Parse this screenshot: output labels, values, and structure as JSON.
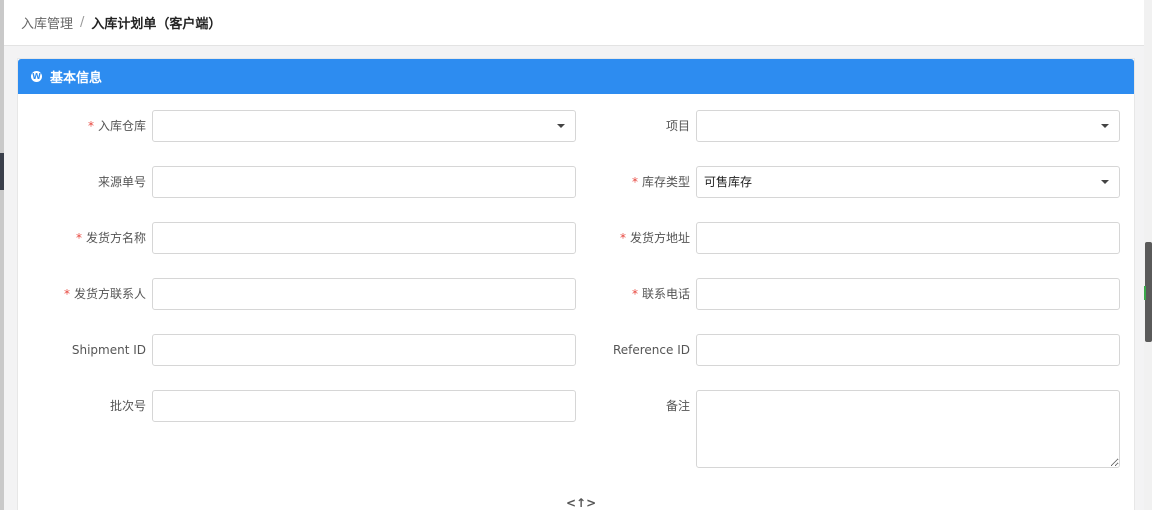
{
  "breadcrumb": {
    "parent": "入库管理",
    "separator": "/",
    "current": "入库计划单（客户端）"
  },
  "panel": {
    "title": "基本信息",
    "icon": "wordpress-icon"
  },
  "form": {
    "warehouse": {
      "label": "入库仓库",
      "required_mark": "*",
      "value": ""
    },
    "project": {
      "label": "项目",
      "value": ""
    },
    "source_no": {
      "label": "来源单号",
      "value": "",
      "placeholder": ""
    },
    "inventory_type": {
      "label": "库存类型",
      "required_mark": "*",
      "value": "可售库存"
    },
    "shipper_name": {
      "label": "发货方名称",
      "required_mark": "*",
      "value": "",
      "placeholder": ""
    },
    "shipper_address": {
      "label": "发货方地址",
      "required_mark": "*",
      "value": "",
      "placeholder": ""
    },
    "shipper_contact": {
      "label": "发货方联系人",
      "required_mark": "*",
      "value": "",
      "placeholder": ""
    },
    "phone": {
      "label": "联系电话",
      "required_mark": "*",
      "value": "",
      "placeholder": ""
    },
    "shipment_id": {
      "label": "Shipment ID",
      "value": "",
      "placeholder": ""
    },
    "reference_id": {
      "label": "Reference ID",
      "value": "",
      "placeholder": ""
    },
    "batch_no": {
      "label": "批次号",
      "value": "",
      "placeholder": ""
    },
    "remarks": {
      "label": "备注",
      "value": "",
      "placeholder": ""
    }
  },
  "collapse_toggle": {
    "glyph": "<↑>"
  },
  "colors": {
    "header_blue": "#2d8cf0",
    "required_red": "#e8473f"
  }
}
